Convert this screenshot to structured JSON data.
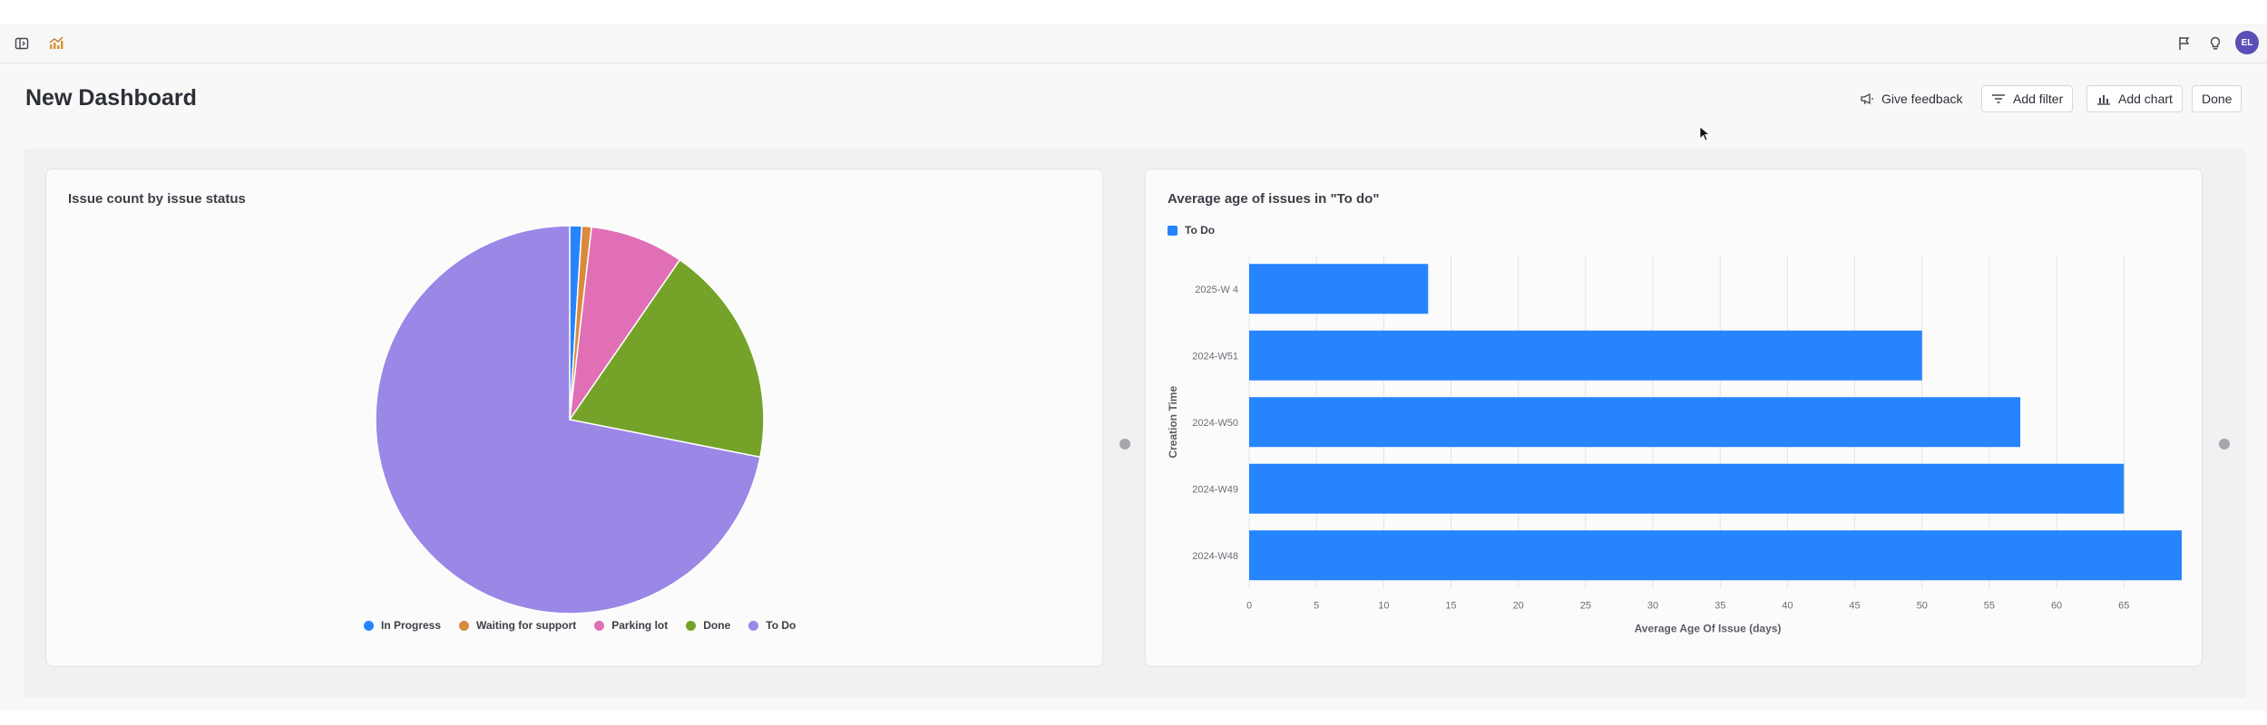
{
  "topbar": {
    "left_icons": [
      "sidebar-toggle-icon",
      "chart-logo-icon"
    ],
    "right_icons": [
      "flag-icon",
      "lightbulb-icon"
    ],
    "avatar_initials": "EL"
  },
  "header": {
    "title": "New Dashboard",
    "actions": {
      "feedback": "Give feedback",
      "filter": "Add filter",
      "chart": "Add chart",
      "done": "Done"
    }
  },
  "charts": {
    "pie": {
      "title": "Issue count by issue status",
      "legend": [
        "In Progress",
        "Waiting for support",
        "Parking lot",
        "Done",
        "To Do"
      ]
    },
    "bar": {
      "title": "Average age of issues in \"To do\"",
      "legend": [
        "To Do"
      ],
      "xlabel": "Average Age Of Issue (days)",
      "ylabel": "Creation Time"
    }
  },
  "colors": {
    "in_progress": "#2684ff",
    "waiting": "#d98a3d",
    "parking": "#e06fb5",
    "done": "#75a229",
    "todo": "#9b87e6",
    "bar": "#2684ff"
  },
  "chart_data": [
    {
      "type": "pie",
      "title": "Issue count by issue status",
      "categories": [
        "In Progress",
        "Waiting for support",
        "Parking lot",
        "Done",
        "To Do"
      ],
      "values": [
        1.0,
        0.8,
        7.8,
        18.5,
        71.9
      ],
      "legend": "bottom"
    },
    {
      "type": "bar",
      "orientation": "horizontal",
      "title": "Average age of issues in \"To do\"",
      "categories": [
        "2025-W 4",
        "2024-W51",
        "2024-W50",
        "2024-W49",
        "2024-W48"
      ],
      "series": [
        {
          "name": "To Do",
          "values": [
            13.3,
            50,
            57.3,
            65,
            69.3
          ]
        }
      ],
      "xlabel": "Average Age Of Issue (days)",
      "ylabel": "Creation Time",
      "xticks": [
        0,
        5,
        10,
        15,
        20,
        25,
        30,
        35,
        40,
        45,
        50,
        55,
        60,
        65
      ],
      "xlim": [
        0,
        69.5
      ],
      "grid": true,
      "legend": "top-left"
    }
  ]
}
